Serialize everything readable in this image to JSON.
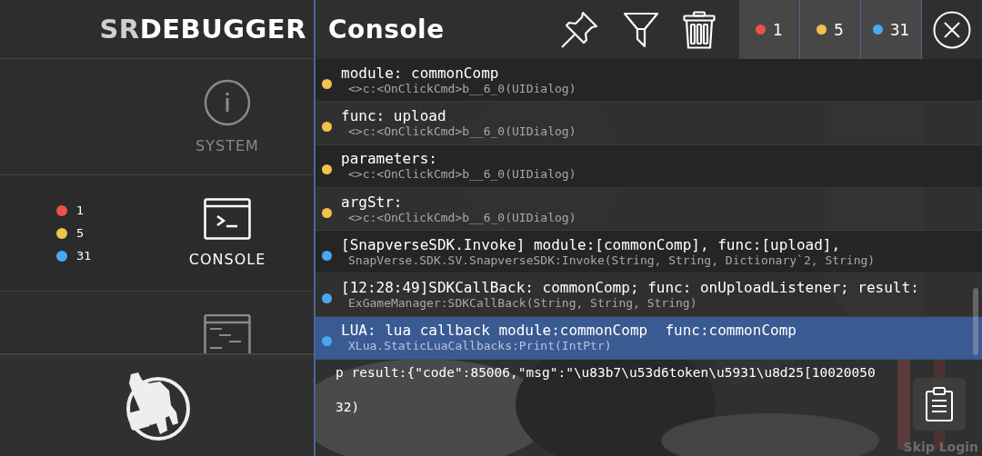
{
  "sidebar": {
    "logo": {
      "prefix": "SR",
      "main": "DEBUGGER"
    },
    "tabs": [
      {
        "kind": "info",
        "label": "SYSTEM",
        "selected": false
      },
      {
        "kind": "console",
        "label": "CONSOLE",
        "selected": true,
        "counts": [
          {
            "count": "1",
            "color": "#e8514c"
          },
          {
            "count": "5",
            "color": "#f2c14e"
          },
          {
            "count": "31",
            "color": "#4aa8f0"
          }
        ]
      },
      {
        "kind": "profiler",
        "selected": false
      }
    ]
  },
  "console": {
    "title": "Console",
    "filters": [
      {
        "count": "1",
        "color": "#e8514c"
      },
      {
        "count": "5",
        "color": "#f2c14e"
      },
      {
        "count": "31",
        "color": "#4aa8f0"
      }
    ],
    "entries": [
      {
        "color": "#f2c14e",
        "message": "module: commonComp",
        "stack": "<>c:<OnClickCmd>b__6_0(UIDialog)",
        "selected": false
      },
      {
        "color": "#f2c14e",
        "message": "func: upload",
        "stack": "<>c:<OnClickCmd>b__6_0(UIDialog)",
        "selected": false
      },
      {
        "color": "#f2c14e",
        "message": "parameters:",
        "stack": "<>c:<OnClickCmd>b__6_0(UIDialog)",
        "selected": false
      },
      {
        "color": "#f2c14e",
        "message": "argStr:",
        "stack": "<>c:<OnClickCmd>b__6_0(UIDialog)",
        "selected": false
      },
      {
        "color": "#4aa8f0",
        "message": "[SnapverseSDK.Invoke] module:[commonComp], func:[upload],",
        "stack": "SnapVerse.SDK.SV.SnapverseSDK:Invoke(String, String, Dictionary`2, String)",
        "selected": false
      },
      {
        "color": "#4aa8f0",
        "message": "[12:28:49]SDKCallBack: commonComp; func: onUploadListener; result:",
        "stack": "ExGameManager:SDKCallBack(String, String, String)",
        "selected": false
      },
      {
        "color": "#4aa8f0",
        "message": "LUA: lua callback module:commonComp  func:commonComp",
        "stack": "XLua.StaticLuaCallbacks:Print(IntPtr)",
        "selected": true
      }
    ],
    "detail": [
      "p result:{\"code\":85006,\"msg\":\"\\u83b7\\u53d6token\\u5931\\u8d25[10020050",
      "32)"
    ],
    "overlay_button": "Skip Login"
  }
}
